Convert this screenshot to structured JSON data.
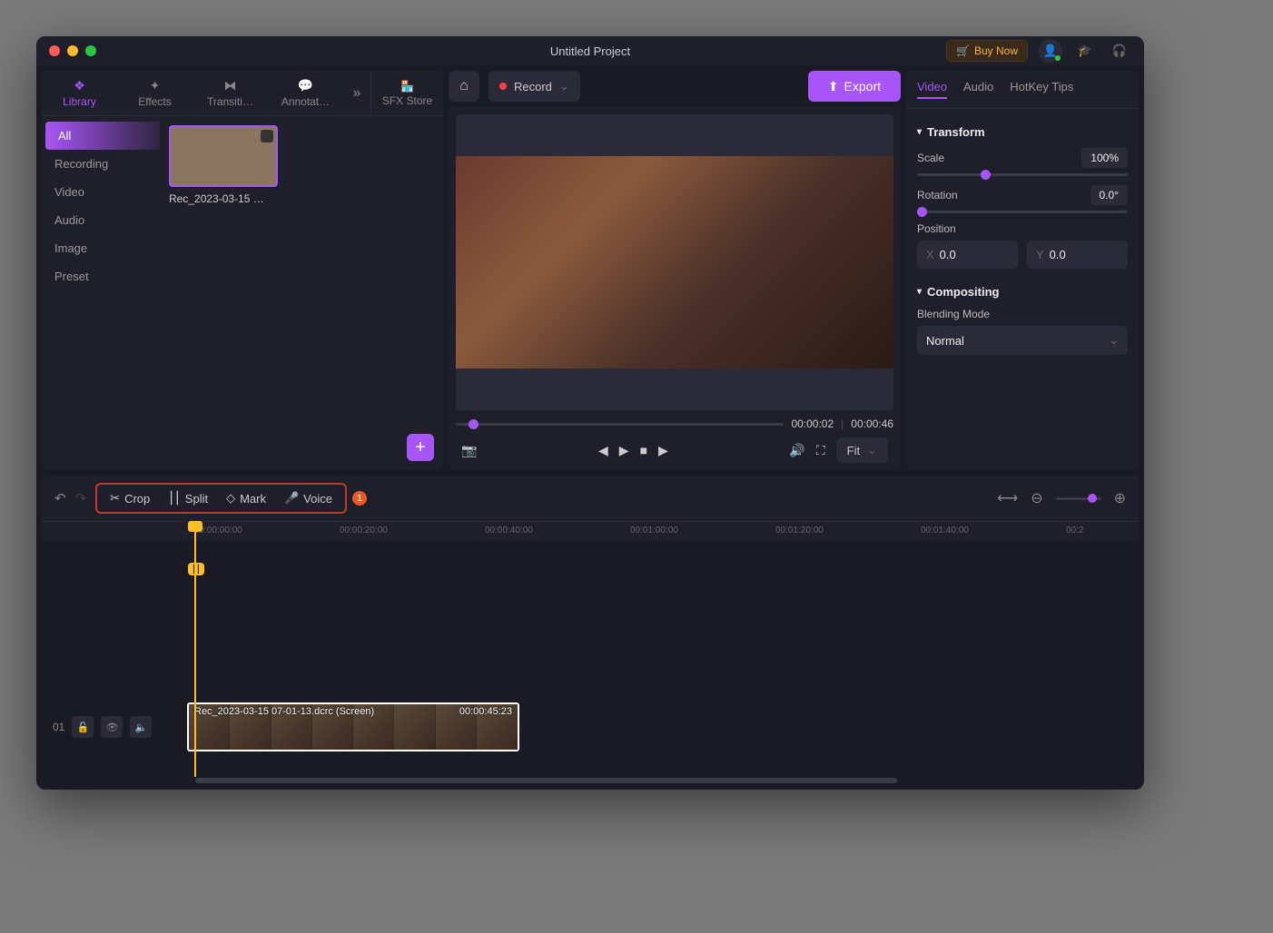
{
  "title": "Untitled Project",
  "titlebar": {
    "buy": "Buy Now"
  },
  "tabs": {
    "library": "Library",
    "effects": "Effects",
    "transitions": "Transiti…",
    "annotations": "Annotat…",
    "sfx": "SFX Store"
  },
  "library": {
    "categories": [
      "All",
      "Recording",
      "Video",
      "Audio",
      "Image",
      "Preset"
    ],
    "clip_name": "Rec_2023-03-15 …"
  },
  "preview": {
    "record": "Record",
    "export": "Export",
    "current": "00:00:02",
    "total": "00:00:46",
    "fit": "Fit"
  },
  "props": {
    "tabs": [
      "Video",
      "Audio",
      "HotKey Tips"
    ],
    "transform": "Transform",
    "scale": "Scale",
    "scale_val": "100%",
    "rotation": "Rotation",
    "rotation_val": "0.0°",
    "position": "Position",
    "pos_x": "0.0",
    "pos_y": "0.0",
    "compositing": "Compositing",
    "blending": "Blending Mode",
    "blending_val": "Normal"
  },
  "tools": {
    "crop": "Crop",
    "split": "Split",
    "mark": "Mark",
    "voice": "Voice",
    "voice_badge": "1"
  },
  "ruler": [
    "00:00:00:00",
    "00:00:20:00",
    "00:00:40:00",
    "00:01:00:00",
    "00:01:20:00",
    "00:01:40:00",
    "00:2"
  ],
  "track": {
    "num": "01",
    "clip_label": "Rec_2023-03-15 07-01-13.dcrc (Screen)",
    "clip_dur": "00:00:45:23"
  }
}
